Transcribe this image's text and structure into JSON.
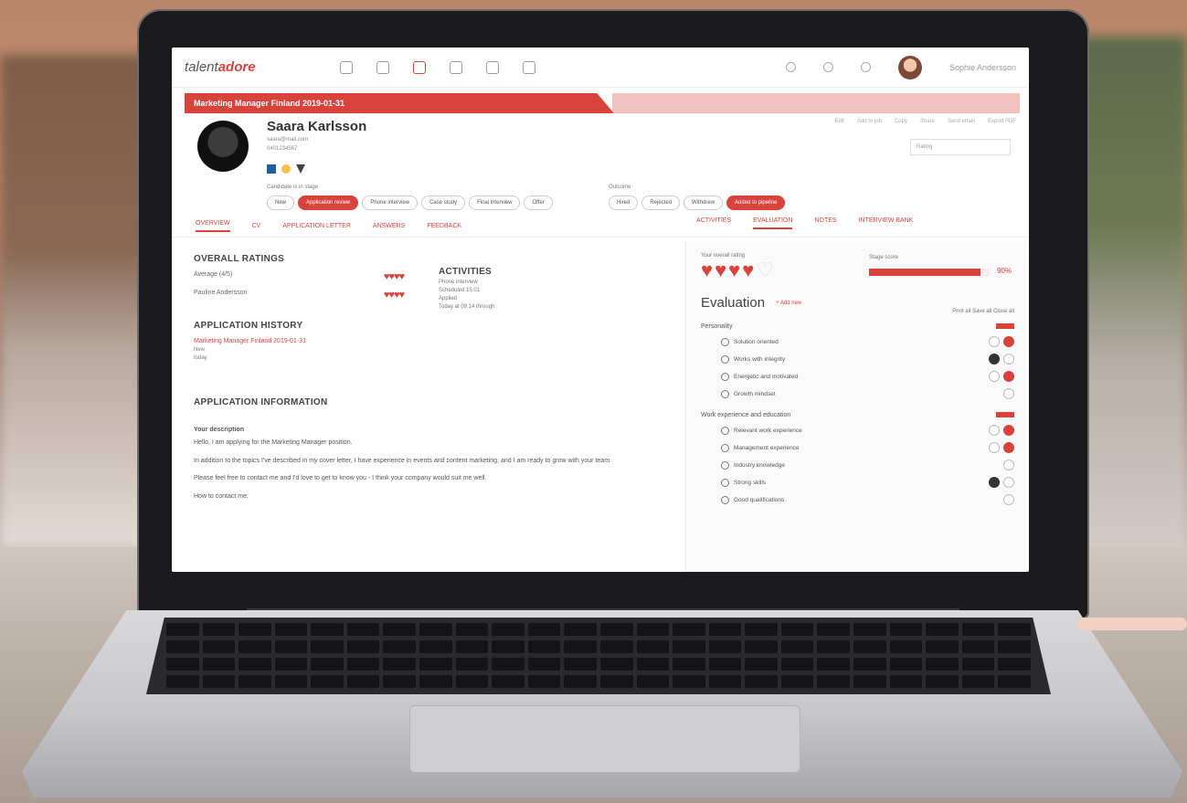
{
  "app": {
    "logo_prefix": "talent",
    "logo_suffix": "adore",
    "user_name": "Sophie Andersson"
  },
  "job_banner": "Marketing Manager Finland 2019-01-31",
  "candidate": {
    "name": "Saara Karlsson",
    "email": "saara@mail.com",
    "phone": "0401234567",
    "stage_label": "Candidate is in stage",
    "stages": [
      "New",
      "Application review",
      "Phone interview",
      "Case study",
      "Final interview",
      "Offer"
    ],
    "active_stage": "Application review",
    "outcome_label": "Outcome",
    "outcomes": [
      "Hired",
      "Rejected",
      "Withdrew"
    ],
    "status_button": "Added to pipeline",
    "actions": [
      "Edit",
      "Add to job",
      "Copy",
      "Share",
      "Send email",
      "Export PDF"
    ],
    "rating_placeholder": "Rating"
  },
  "tabs": [
    "OVERVIEW",
    "CV",
    "APPLICATION LETTER",
    "ANSWERS",
    "FEEDBACK"
  ],
  "right_tabs": [
    "ACTIVITIES",
    "EVALUATION",
    "NOTES",
    "INTERVIEW BANK"
  ],
  "overall": {
    "title": "OVERALL RATINGS",
    "rows": [
      {
        "label": "Average (4/5)",
        "hearts": "♥♥♥♥"
      },
      {
        "label": "Pauline Andersson",
        "hearts": "♥♥♥♥"
      }
    ]
  },
  "activities": {
    "title": "ACTIVITIES",
    "lines": [
      "Phone interview",
      "Scheduled 15.01",
      "Applied",
      "Today at 09:14 through"
    ]
  },
  "history": {
    "title": "APPLICATION HISTORY",
    "link": "Marketing Manager Finland 2019-01-31",
    "status": "New",
    "date": "today"
  },
  "application_info": {
    "title": "APPLICATION INFORMATION",
    "subtitle": "Your description",
    "p1": "Hello, I am applying for the Marketing Manager position.",
    "p2": "In addition to the topics I've described in my cover letter, I have experience in events and content marketing, and I am ready to grow with your team.",
    "p3": "Please feel free to contact me and I'd love to get to know you - I think your company would suit me well.",
    "p4": "How to contact me:"
  },
  "evaluation": {
    "your_rating_label": "Your overall rating",
    "stage_score_label": "Stage score",
    "stage_score": "90%",
    "title": "Evaluation",
    "add_new": "+ Add new",
    "links": "Print all  Save all  Close all",
    "sections": [
      {
        "name": "Personality",
        "items": [
          "Solution oriented",
          "Works with integrity",
          "Energetic and motivated",
          "Growth mindset"
        ]
      },
      {
        "name": "Work experience and education",
        "items": [
          "Relevant work experience",
          "Management experience",
          "Industry knowledge",
          "Strong skills",
          "Good qualifications"
        ]
      }
    ]
  },
  "colors": {
    "accent": "#d8433c",
    "accent_light": "#e9908b"
  },
  "icons": [
    "home-icon",
    "jobs-icon",
    "candidates-icon",
    "people-icon",
    "reports-icon",
    "settings-icon",
    "help-icon",
    "messages-icon",
    "notifications-icon"
  ]
}
